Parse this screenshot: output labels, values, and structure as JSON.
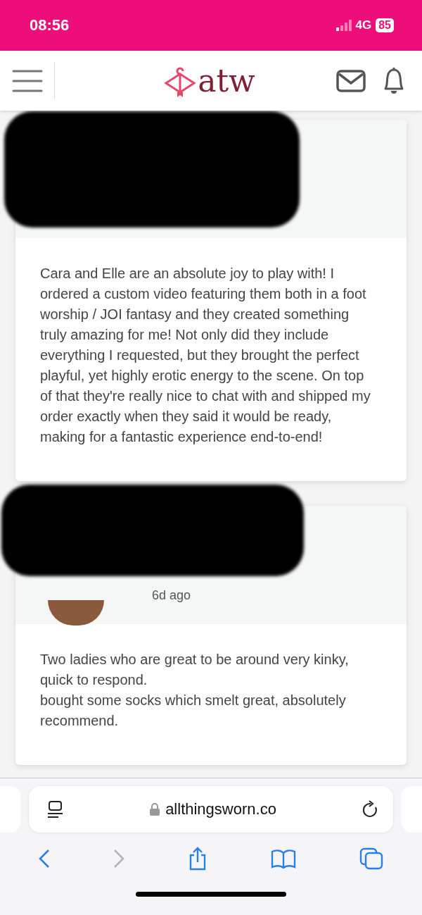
{
  "status_bar": {
    "time": "08:56",
    "network": "4G",
    "battery": "85"
  },
  "header": {
    "logo": "atw"
  },
  "reviews": [
    {
      "text": "Cara and Elle are an absolute joy to play with! I ordered a custom video featuring them both in a foot worship / JOI fantasy and they created something truly amazing for me! Not only did they include everything I requested, but they brought the perfect playful, yet highly erotic energy to the scene. On top of that they're really nice to chat with and shipped my order exactly when they said it would be ready, making for a fantastic experience end-to-end!"
    },
    {
      "date": "6d ago",
      "text": "Two ladies who are great to be around very kinky, quick to respond.\nbought some socks which smelt great, absolutely recommend."
    }
  ],
  "browser": {
    "url": "allthingsworn.co"
  }
}
